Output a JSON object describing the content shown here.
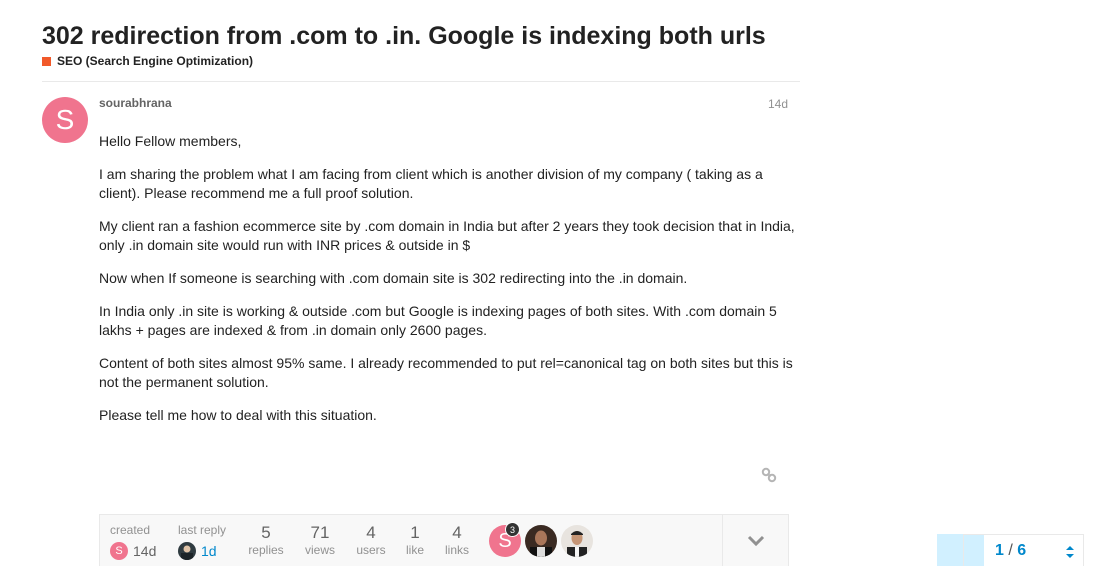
{
  "topic": {
    "title": "302 redirection from .com to .in. Google is indexing both urls",
    "category": "SEO (Search Engine Optimization)",
    "category_color": "#f1592a"
  },
  "post": {
    "avatar_letter": "S",
    "avatar_color": "#f0748e",
    "username": "sourabhrana",
    "date": "14d",
    "paragraphs": [
      "Hello Fellow members,",
      "I am sharing the problem what I am facing from client which is another division of my company ( taking as a client). Please recommend me a full proof solution.",
      "My client ran a fashion ecommerce site by .com domain in India but after 2 years they took decision that in India, only .in domain site would run with INR prices & outside in $",
      "Now when If someone is searching with .com domain site is 302 redirecting into the .in domain.",
      "In India only .in site is working & outside .com but Google is indexing pages of both sites. With .com domain 5 lakhs + pages are indexed & from .in domain only 2600 pages.",
      "Content of both sites almost 95% same. I already recommended to put rel=canonical tag on both sites but this is not the permanent solution.",
      "Please tell me how to deal with this situation."
    ],
    "link_icon": "link-icon"
  },
  "topic_map": {
    "created_label": "created",
    "created_date": "14d",
    "created_avatar_letter": "S",
    "last_reply_label": "last reply",
    "last_reply_date": "1d",
    "stats": [
      {
        "value": "5",
        "label": "replies"
      },
      {
        "value": "71",
        "label": "views"
      },
      {
        "value": "4",
        "label": "users"
      },
      {
        "value": "1",
        "label": "like"
      },
      {
        "value": "4",
        "label": "links"
      }
    ],
    "participants": [
      {
        "letter": "S",
        "color": "#f0748e",
        "badge": "3"
      },
      {
        "letter": "",
        "color": "#3a2a22",
        "badge": ""
      },
      {
        "letter": "",
        "color": "#cfc8c0",
        "badge": ""
      }
    ],
    "expand_icon": "chevron-down-icon"
  },
  "progress": {
    "current": "1",
    "separator": "/",
    "total": "6",
    "fraction": 0.1667,
    "arrows_icon": "sort-arrows-icon"
  }
}
